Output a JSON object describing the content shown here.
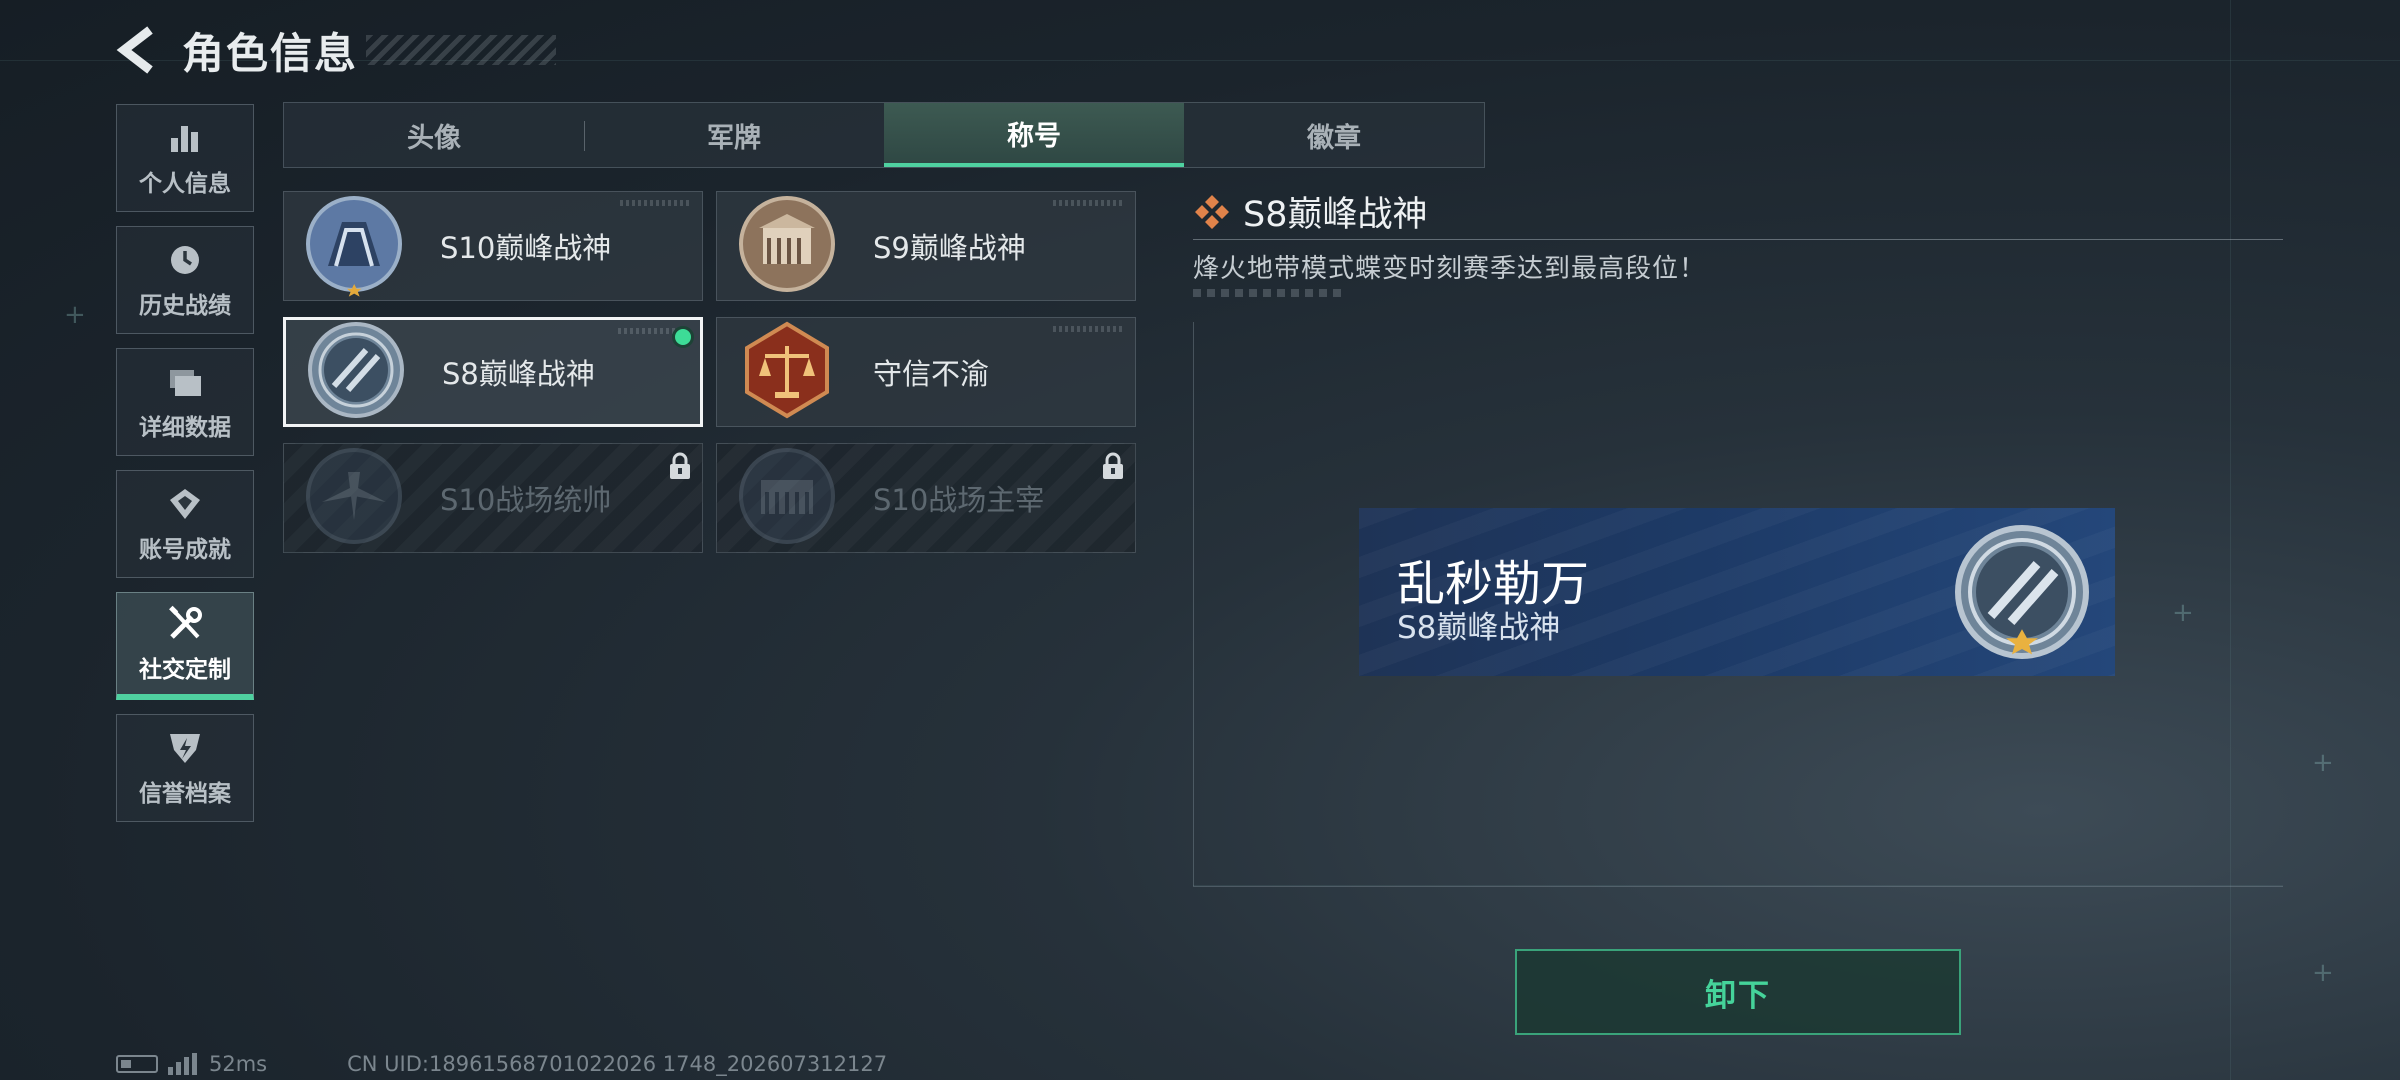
{
  "header": {
    "title": "角色信息"
  },
  "sidebar": {
    "items": [
      {
        "label": "个人信息",
        "icon": "bar-chart-icon"
      },
      {
        "label": "历史战绩",
        "icon": "clock-history-icon"
      },
      {
        "label": "详细数据",
        "icon": "folders-icon"
      },
      {
        "label": "账号成就",
        "icon": "achievement-icon"
      },
      {
        "label": "社交定制",
        "icon": "tools-icon",
        "active": true
      },
      {
        "label": "信誉档案",
        "icon": "shield-badge-icon"
      }
    ]
  },
  "tabs": [
    {
      "label": "头像"
    },
    {
      "label": "军牌"
    },
    {
      "label": "称号",
      "active": true
    },
    {
      "label": "徽章"
    }
  ],
  "titles": [
    {
      "name": "S10巅峰战神",
      "state": "unlocked"
    },
    {
      "name": "S9巅峰战神",
      "state": "unlocked"
    },
    {
      "name": "S8巅峰战神",
      "state": "selected-equipped"
    },
    {
      "name": "守信不渝",
      "state": "unlocked"
    },
    {
      "name": "S10战场统帅",
      "state": "locked"
    },
    {
      "name": "S10战场主宰",
      "state": "locked"
    }
  ],
  "detail": {
    "title": "S8巅峰战神",
    "description": "烽火地带模式蝶变时刻赛季达到最高段位！"
  },
  "nameplate": {
    "player_name": "乱秒勒万",
    "title": "S8巅峰战神"
  },
  "actions": {
    "unequip_label": "卸下"
  },
  "status": {
    "ping": "52ms",
    "uid": "CN UID:18961568701022026 1748_202607312127"
  },
  "colors": {
    "accent": "#4fd1a0",
    "equipped_dot": "#3ddc97",
    "button_text": "#45d39a",
    "plate_bg": "#1d3a66"
  }
}
